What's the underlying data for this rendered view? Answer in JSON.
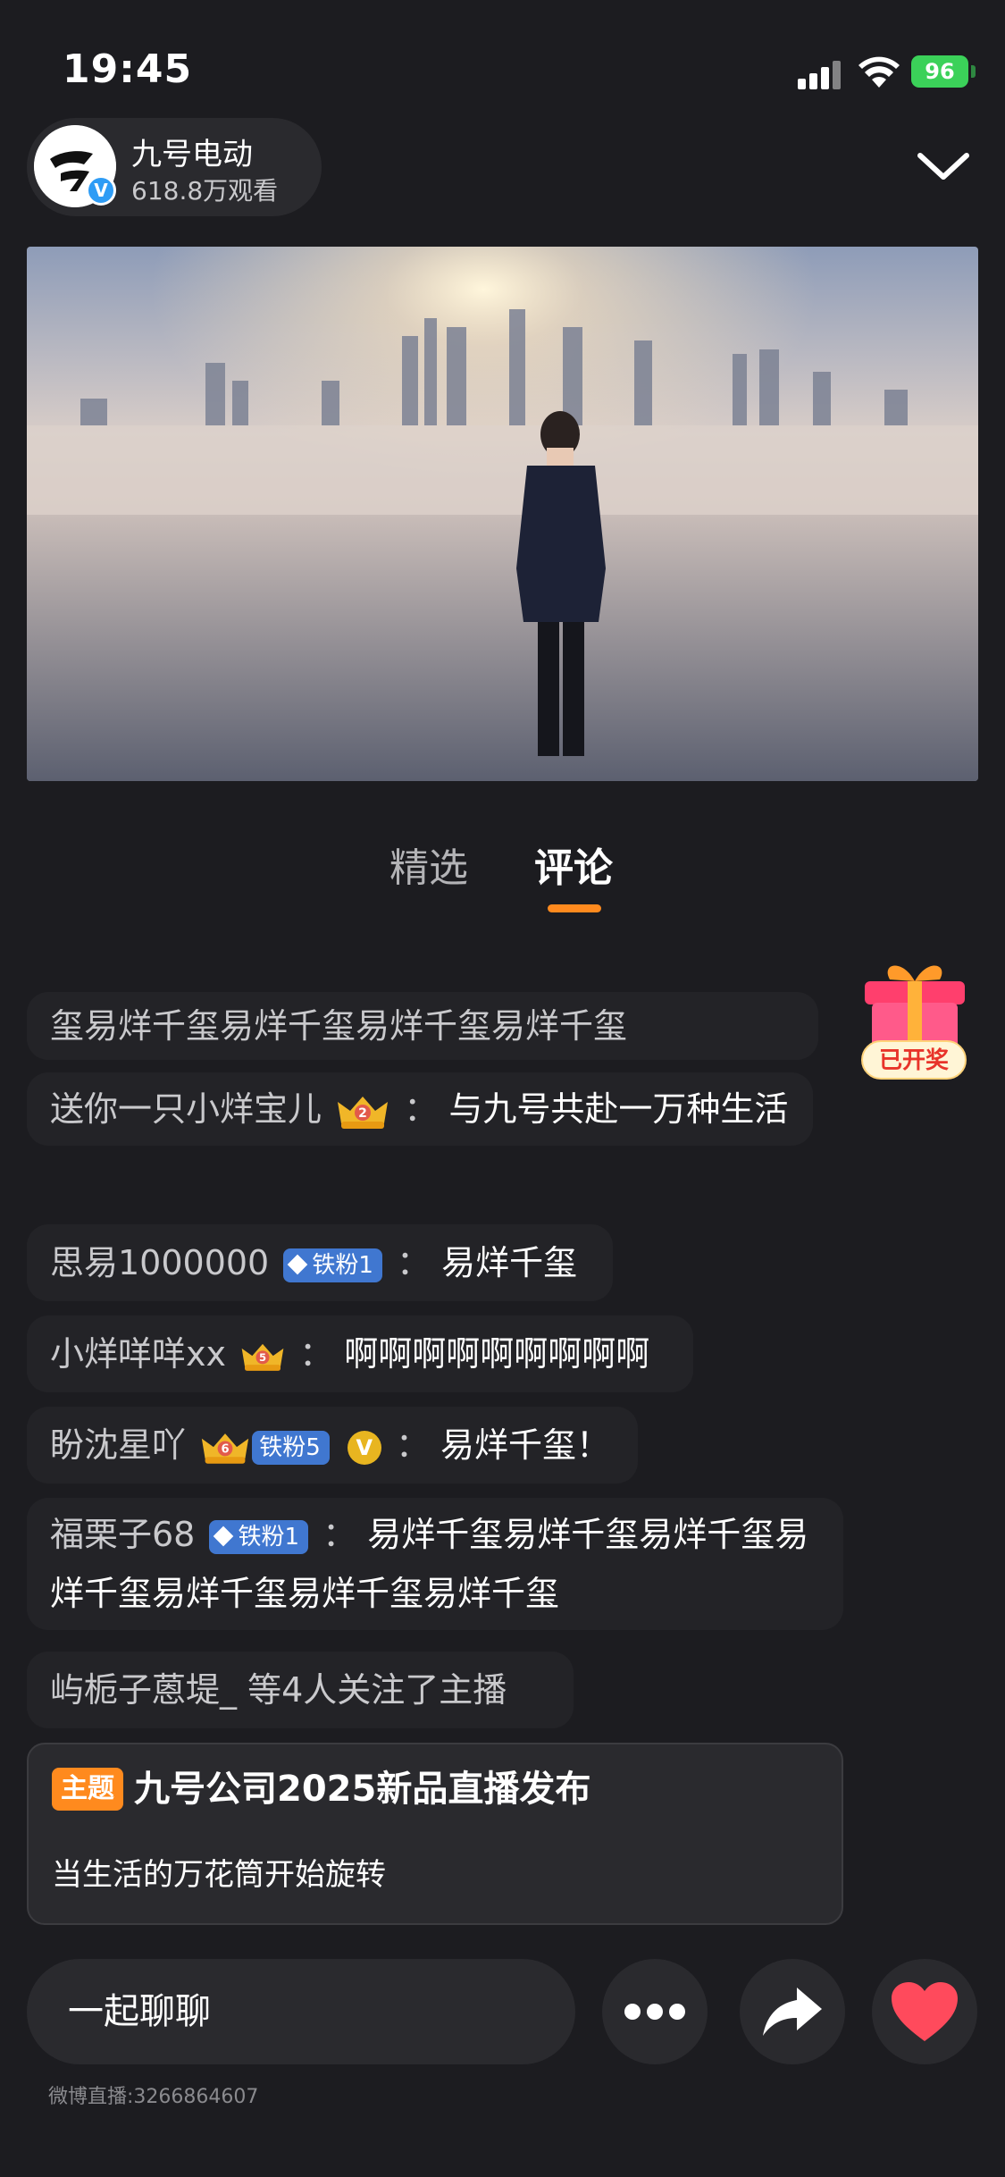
{
  "status_bar": {
    "time": "19:45",
    "battery": "96"
  },
  "host": {
    "name": "九号电动",
    "viewers": "618.8万观看",
    "verified_mark": "V"
  },
  "tabs": [
    {
      "label": "精选"
    },
    {
      "label": "评论"
    }
  ],
  "comments": [
    {
      "text": "玺易烊千玺易烊千玺易烊千玺易烊千玺"
    },
    {
      "nick": "送你一只小烊宝儿",
      "crown_level": "2",
      "sep": "：",
      "message": "与九号共赴一万种生活"
    },
    {
      "nick": "思易1000000",
      "badge": "铁粉1",
      "sep": "：",
      "message": "易烊千玺"
    },
    {
      "nick": "小烊咩咩xx",
      "crown_level": "5",
      "sep": "：",
      "message": "啊啊啊啊啊啊啊啊啊"
    },
    {
      "nick": "盼沈星吖",
      "crown_level": "6",
      "badge": "铁粉5",
      "vmark": "V",
      "sep": "：",
      "message": "易烊千玺！"
    },
    {
      "nick": "福栗子68",
      "badge": "铁粉1",
      "sep": "：",
      "message": "易烊千玺易烊千玺易烊千玺易烊千玺易烊千玺易烊千玺易烊千玺"
    },
    {
      "text": "屿栀子蒽堤_ 等4人关注了主播"
    }
  ],
  "gift": {
    "label": "已开奖"
  },
  "topic": {
    "tag": "主题",
    "title": "九号公司2025新品直播发布",
    "subtitle": "当生活的万花筒开始旋转"
  },
  "chat": {
    "placeholder": "一起聊聊"
  },
  "footer": {
    "id": "微博直播:3266864607"
  },
  "colors": {
    "accent": "#ff8a1e",
    "badge_blue": "#4077d0",
    "like_red": "#ff4a5c",
    "background": "#1c1c20"
  },
  "icons": [
    "signal-icon",
    "wifi-icon",
    "battery-icon",
    "brand-logo-icon",
    "verified-icon",
    "chevron-down-icon",
    "crown-icon",
    "diamond-icon",
    "gift-box-icon",
    "more-icon",
    "share-icon",
    "heart-icon"
  ]
}
